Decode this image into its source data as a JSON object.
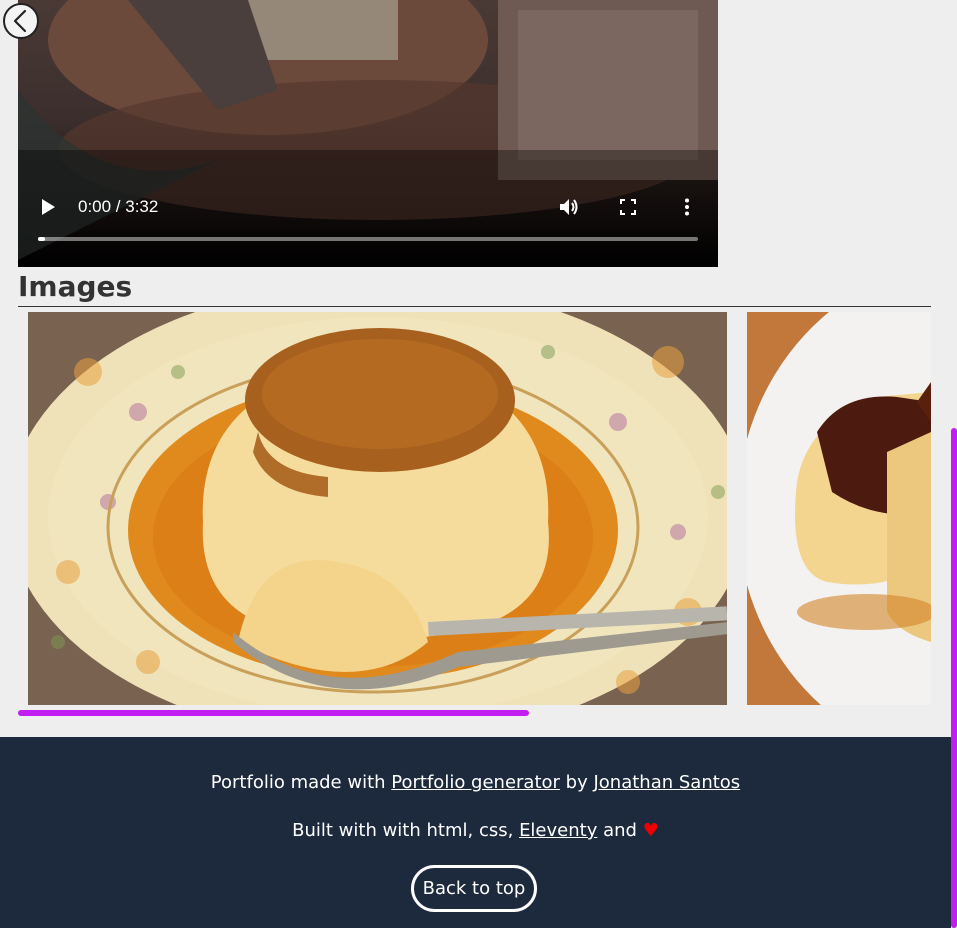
{
  "video": {
    "time_display": "0:00 / 3:32",
    "current_time": "0:00",
    "duration": "3:32",
    "progress_fraction": 0.01
  },
  "icons": {
    "back": "chevron-left-icon",
    "play": "play-icon",
    "volume": "volume-icon",
    "fullscreen": "fullscreen-icon",
    "more": "more-vertical-icon"
  },
  "images_section": {
    "heading": "Images",
    "scroll_fraction": 0.56
  },
  "footer": {
    "line1_prefix": "Portfolio made with",
    "line1_link1": "Portfolio generator",
    "line1_middle": "by",
    "line1_link2": "Jonathan Santos",
    "line2_prefix": "Built with with html, css,",
    "line2_link": "Eleventy",
    "line2_suffix": "and",
    "heart": "♥",
    "back_to_top": "Back to top"
  },
  "colors": {
    "accent": "#c21ef2",
    "footer_bg": "#1d2a3d",
    "page_bg": "#eeeeee",
    "heart": "#ee0000"
  }
}
